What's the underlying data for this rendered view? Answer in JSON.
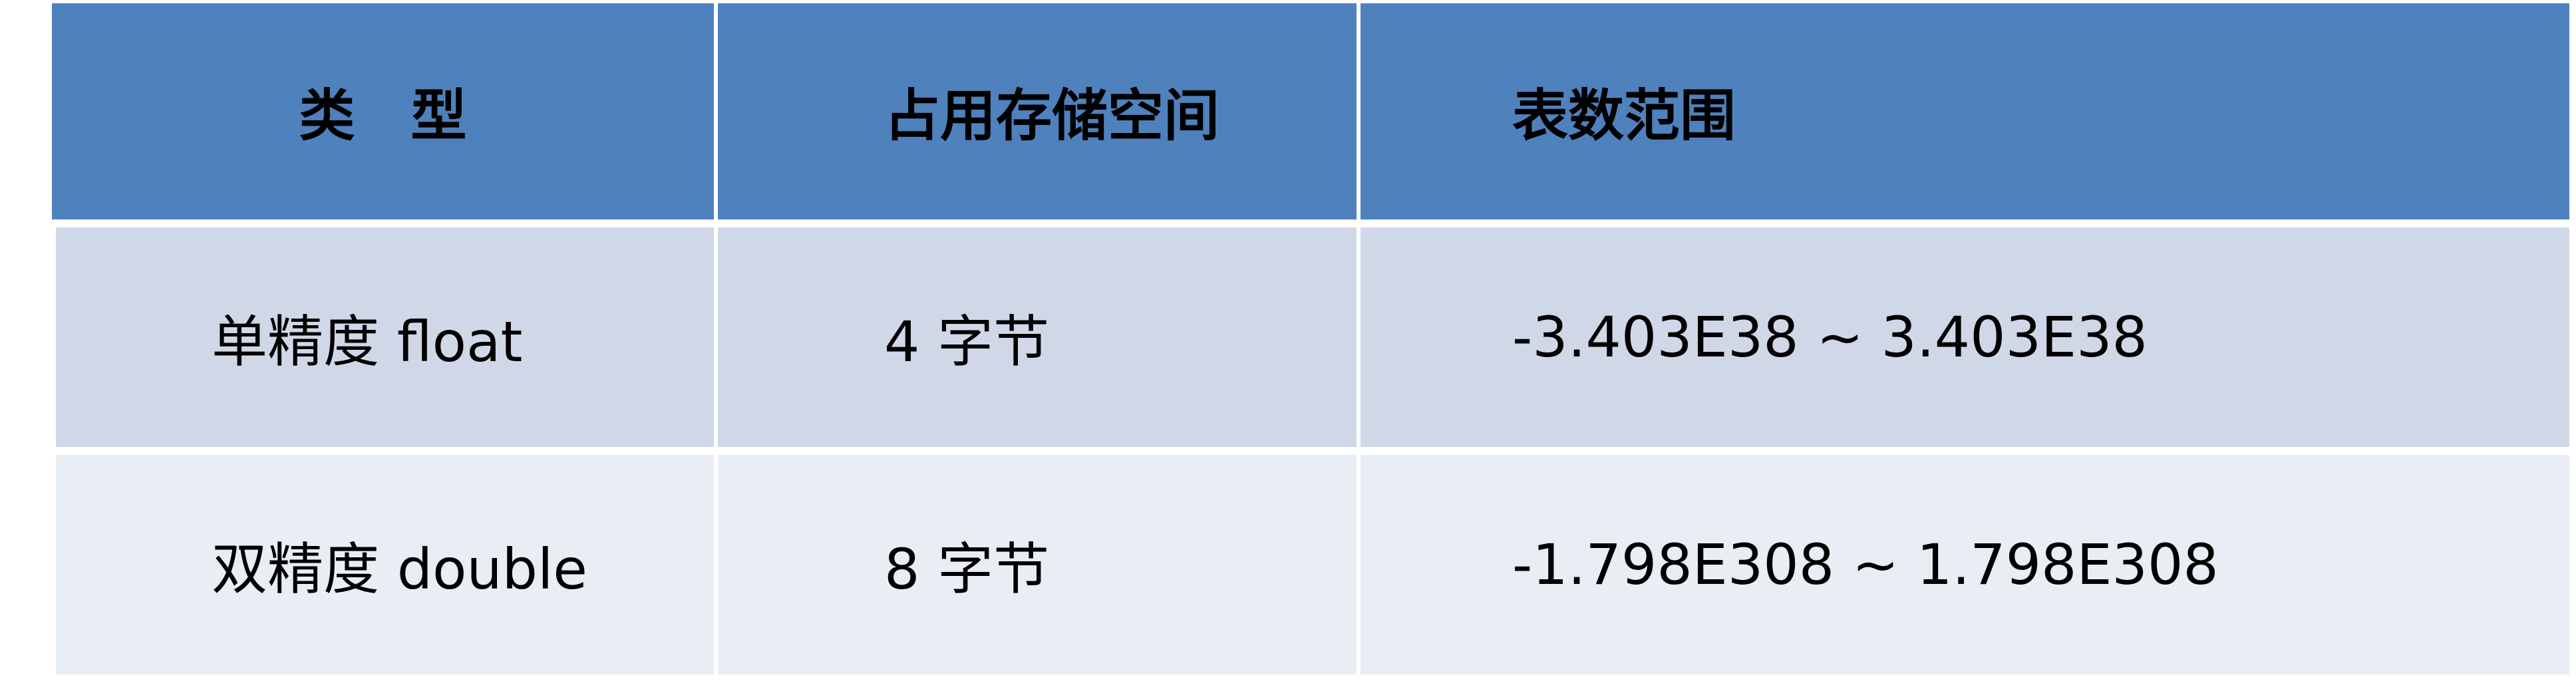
{
  "table": {
    "headers": [
      "类　型",
      "占用存储空间",
      "表数范围"
    ],
    "rows": [
      [
        "单精度 float",
        "4 字节",
        "-3.403E38 ~ 3.403E38"
      ],
      [
        "双精度 double",
        "8 字节",
        "-1.798E308 ~ 1.798E308"
      ]
    ]
  },
  "colors": {
    "header_bg": "#4f81bd",
    "row1_bg": "#d0d8e8",
    "row2_bg": "#e9edf4",
    "gridline": "#ffffff"
  }
}
